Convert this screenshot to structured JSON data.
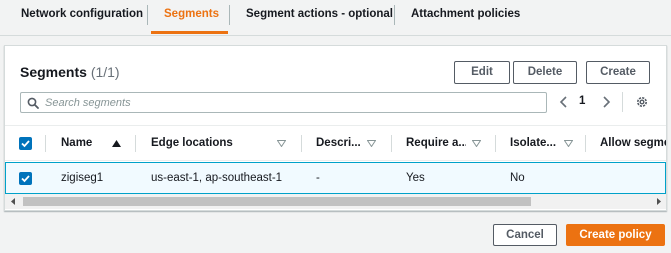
{
  "tabs": [
    {
      "label": "Network configuration"
    },
    {
      "label": "Segments",
      "active": true
    },
    {
      "label": "Segment actions - optional"
    },
    {
      "label": "Attachment policies"
    }
  ],
  "panel": {
    "title": "Segments",
    "count": "(1/1)",
    "buttons": {
      "edit": "Edit",
      "delete": "Delete",
      "create": "Create"
    }
  },
  "search": {
    "placeholder": "Search segments",
    "value": ""
  },
  "pagination": {
    "current_page": "1"
  },
  "table": {
    "header_checked": true,
    "columns": [
      {
        "label": "Name",
        "sort": "ascending"
      },
      {
        "label": "Edge locations"
      },
      {
        "label": "Descri..."
      },
      {
        "label": "Require a..."
      },
      {
        "label": "Isolate..."
      },
      {
        "label": "Allow segmen"
      }
    ],
    "rows": [
      {
        "selected": true,
        "name": "zigiseg1",
        "edge_locations": "us-east-1, ap-southeast-1",
        "description": "-",
        "require_acceptance": "Yes",
        "isolate_attachments": "No",
        "allow_segments": ""
      }
    ]
  },
  "footer": {
    "cancel": "Cancel",
    "primary": "Create policy"
  },
  "colors": {
    "accent": "#ec7211",
    "link_blue": "#0073bb",
    "selected_row_bg": "#f1faff",
    "selected_row_border": "#00a1c9"
  },
  "icons": [
    "search-icon",
    "chevron-left-icon",
    "chevron-right-icon",
    "gear-icon",
    "sort-ascending-icon",
    "sort-descending-icon",
    "check-icon"
  ]
}
